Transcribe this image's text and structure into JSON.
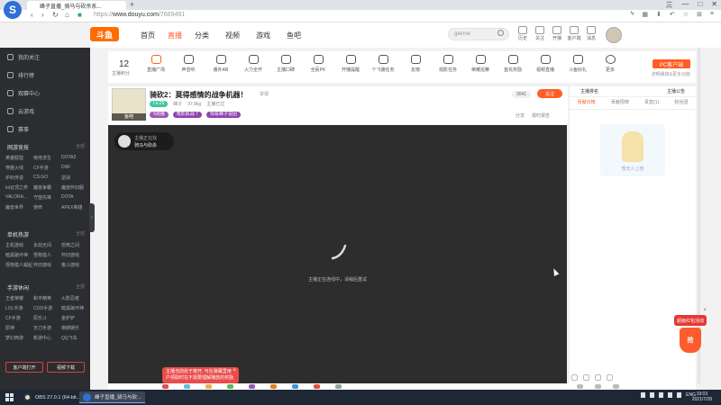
{
  "browser": {
    "tab_title": "峰子直播_骑马与砍杀系...",
    "url_prefix": "https://",
    "url_host": "www.douyu.com",
    "url_path": "/7669491",
    "window_controls": [
      "三",
      "—",
      "□",
      "✕"
    ]
  },
  "site": {
    "logo": "斗鱼",
    "nav": [
      "首页",
      "直播",
      "分类",
      "视频",
      "游戏",
      "鱼吧"
    ],
    "search_placeholder": "glenne",
    "header_tools": [
      "历史",
      "关注",
      "开播",
      "客户端",
      "消息"
    ]
  },
  "sidebar": {
    "top_items": [
      "我的关注",
      "排行榜",
      "观赛中心",
      "云游戏"
    ],
    "esports_label": "赛事",
    "online_section": "网游竞技",
    "online_games": [
      "英雄联盟",
      "绝地求生",
      "DOTA2",
      "穿越火线",
      "CF手游",
      "DNF",
      "炉石传说",
      "CS:GO",
      "逆战",
      "lol云顶之弈",
      "魔兽争霸",
      "魔兽怀旧服",
      "VALORA...",
      "守望先锋",
      "DOTA",
      "魔兽世界",
      "使命",
      "APEX英雄"
    ],
    "single_section": "单机热游",
    "single_games": [
      "主机游戏",
      "永劫无间",
      "恐怖之间",
      "暗黑破坏神",
      "怪物猎人",
      "怀旧游戏",
      "怪物猎人崛起",
      "怀旧游戏",
      "格斗游戏"
    ],
    "mobile_section": "手游休闲",
    "mobile_games": [
      "王者荣耀",
      "和平精英",
      "火影忍者",
      "LOL手游",
      "COD手游",
      "暗黑破坏神",
      "CF手游",
      "原乐斗",
      "金铲铲",
      "原神",
      "天刀手游",
      "棋牌娱乐",
      "梦幻西游",
      "新游中心",
      "QQ飞车"
    ],
    "more_label": "全部",
    "bottom_buttons": [
      "客户端打开",
      "视频下载"
    ]
  },
  "toolbar": {
    "level": "12",
    "level_label": "主播积分",
    "features": [
      "直播广场",
      "声音听",
      "番外AB",
      "火力全开",
      "主播口碑",
      "全民PK",
      "开播提醒",
      "个飞播任务",
      "友榜",
      "观影任务",
      "荣耀巡察",
      "首充奖励",
      "视频直播",
      "斗鱼好礼",
      "更多"
    ],
    "pc_button": "PC客户端",
    "pc_sub": "流畅播放&更多功能"
  },
  "room": {
    "title": "骑砍2：莫得感情的战争机器！",
    "report": "举报",
    "level_badge": "LV.29",
    "anchor_name": "峰子",
    "category": "97.8kg",
    "room_status": "主播已过",
    "tags": [
      {
        "text": "5周播",
        "color": "#9b59b6"
      },
      {
        "text": "暗影肌战  7",
        "color": "#8e44ad"
      },
      {
        "text": "观看峰子说团  ",
        "color": "#8e44ad"
      }
    ],
    "viewers": "3041",
    "follow_label": "关注",
    "share_label": "分享",
    "report2_label": "报时报告",
    "avatar_tag": "鱼吧"
  },
  "player": {
    "anchor_status": "主播正在找",
    "anchor_name": "骑马与砍杀",
    "offline_message": "主播正在连线中，请稍后重试",
    "toast": "主播当前处于离开, 可在弹幕里用户领取时在不需要理解播放的奖励"
  },
  "right_panel": {
    "top_tabs": [
      "主播排名",
      "主播公告"
    ],
    "tabs": [
      "贡献日榜",
      "贡献周榜",
      "贵宾(1)",
      "粉丝团"
    ],
    "active_tab": 0,
    "empty_text": "暂无人上榜"
  },
  "side_ad": {
    "label": "超级红包活动",
    "bag": "抢"
  },
  "taskbar": {
    "items": [
      "OBS 27.0.1 (64-bit...",
      "峰子直播_骑马与砍..."
    ],
    "tray": "ENG",
    "time": "19:03",
    "date": "2021/7/28"
  },
  "colors": {
    "accent": "#ff5d23",
    "sidebar_bg": "#2b2d31",
    "player_bg": "#2d2d2d",
    "taskbar_bg": "#1e2835"
  }
}
